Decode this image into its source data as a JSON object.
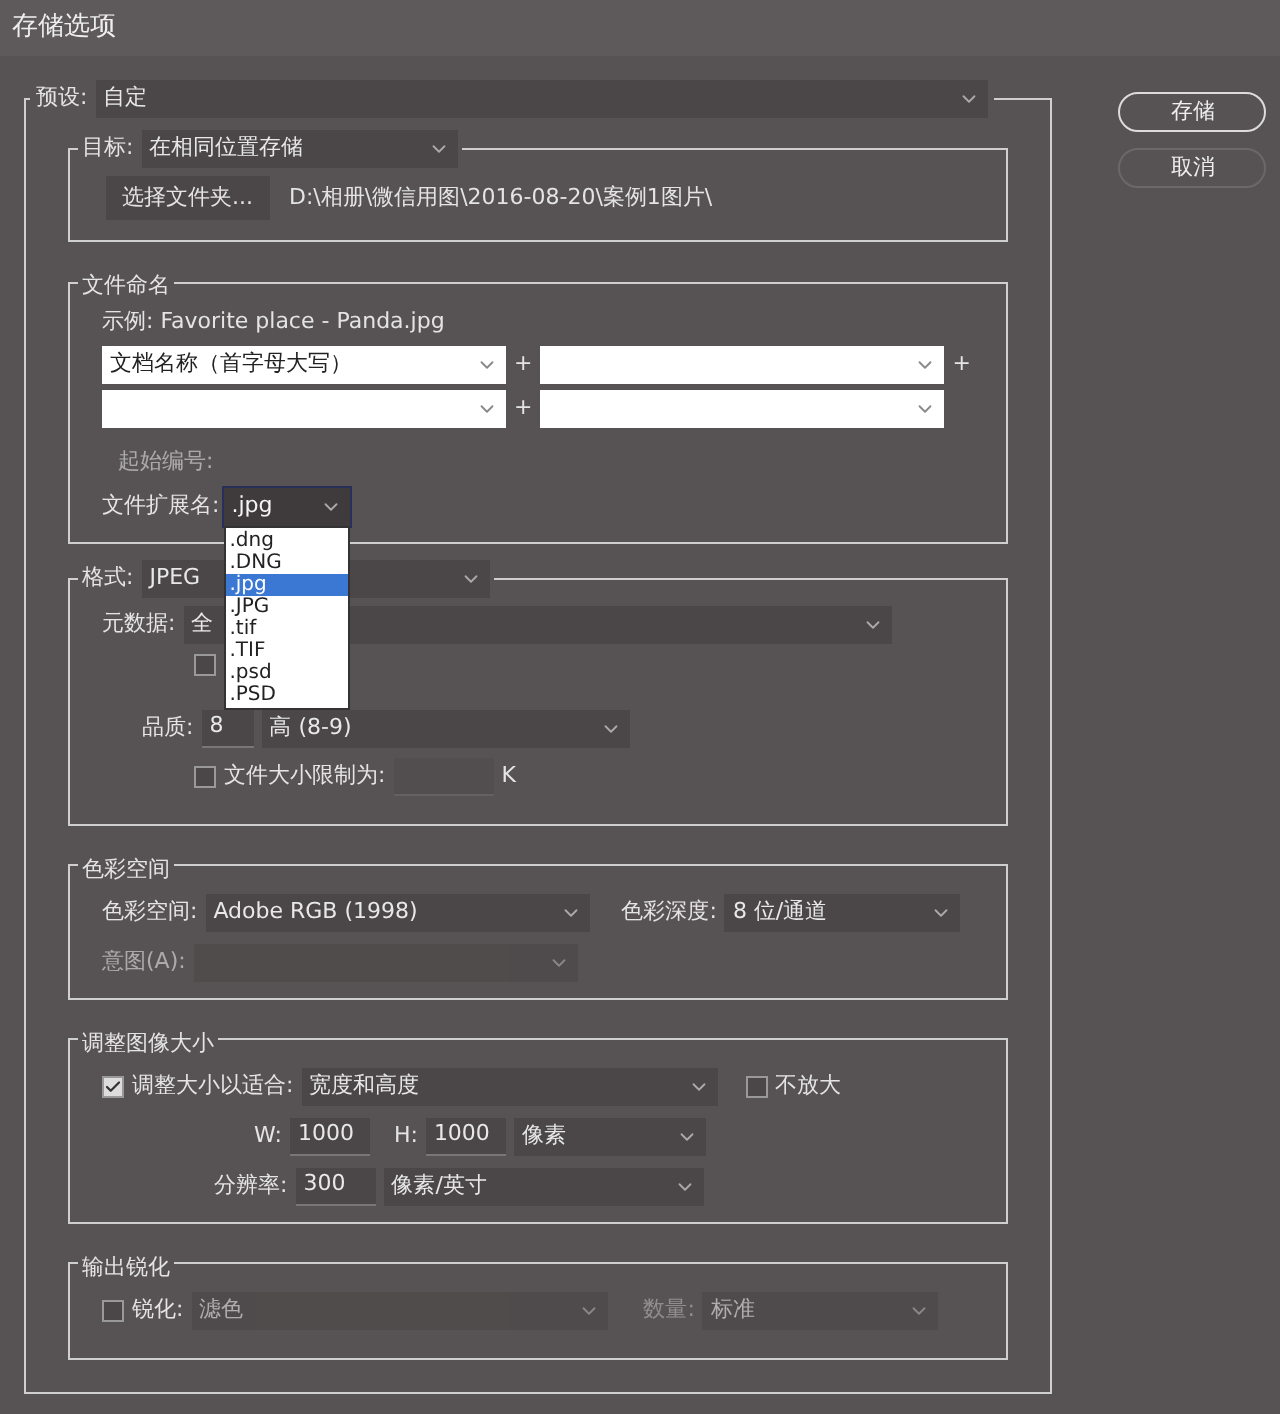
{
  "window": {
    "title": "存储选项"
  },
  "preset": {
    "label": "预设:",
    "value": "自定"
  },
  "buttons": [
    {
      "label": "存储",
      "default": true
    },
    {
      "label": "取消",
      "default": false
    }
  ],
  "destination": {
    "label": "目标:",
    "value": "在相同位置存储",
    "choose_button": "选择文件夹...",
    "path": "D:\\相册\\微信用图\\2016-08-20\\案例1图片\\"
  },
  "file_naming": {
    "title": "文件命名",
    "example": "示例: Favorite place - Panda.jpg",
    "rows": [
      [
        {
          "value": "文档名称（首字母大写）",
          "plus": "+"
        },
        {
          "plus": "+"
        }
      ],
      [
        {
          "plus": "+"
        },
        {}
      ]
    ],
    "start_number": {
      "label": "起始编号:",
      "disabled": true
    },
    "extension": {
      "label": "文件扩展名:",
      "value": ".jpg",
      "expanded": true,
      "options": [
        {
          "label": ".dng",
          "selected": false
        },
        {
          "label": ".DNG",
          "selected": false
        },
        {
          "label": ".jpg",
          "selected": true
        },
        {
          "label": ".JPG",
          "selected": false
        },
        {
          "label": ".tif",
          "selected": false
        },
        {
          "label": ".TIF",
          "selected": false
        },
        {
          "label": ".psd",
          "selected": false
        },
        {
          "label": ".PSD",
          "selected": false
        }
      ]
    }
  },
  "format": {
    "label": "格式:",
    "value": "JPEG",
    "metadata_label": "元数据:",
    "metadata_value": "全",
    "metadata_checkbox": {
      "checked": false
    },
    "quality_label": "品质:",
    "quality_value": "8",
    "quality_text": "高 (8-9)",
    "size_limit": {
      "checked": false,
      "label": "文件大小限制为:",
      "unit": "K"
    }
  },
  "color_space": {
    "title": "色彩空间",
    "space_label": "色彩空间:",
    "space_value": "Adobe RGB (1998)",
    "depth_label": "色彩深度:",
    "depth_value": "8 位/通道",
    "intent_label": "意图(A):",
    "intent_disabled": true
  },
  "resize": {
    "title": "调整图像大小",
    "fit": {
      "checked": true,
      "label": "调整大小以适合:"
    },
    "fit_value": "宽度和高度",
    "no_enlarge": {
      "checked": false,
      "label": "不放大"
    },
    "w_label": "W:",
    "w_value": "1000",
    "h_label": "H:",
    "h_value": "1000",
    "size_unit": "像素",
    "resolution_label": "分辨率:",
    "resolution_value": "300",
    "resolution_unit": "像素/英寸"
  },
  "sharpen": {
    "title": "输出锐化",
    "enable": {
      "checked": false,
      "label": "锐化:"
    },
    "value": "滤色",
    "amount_label": "数量:",
    "amount_value": "标准",
    "disabled": true
  }
}
